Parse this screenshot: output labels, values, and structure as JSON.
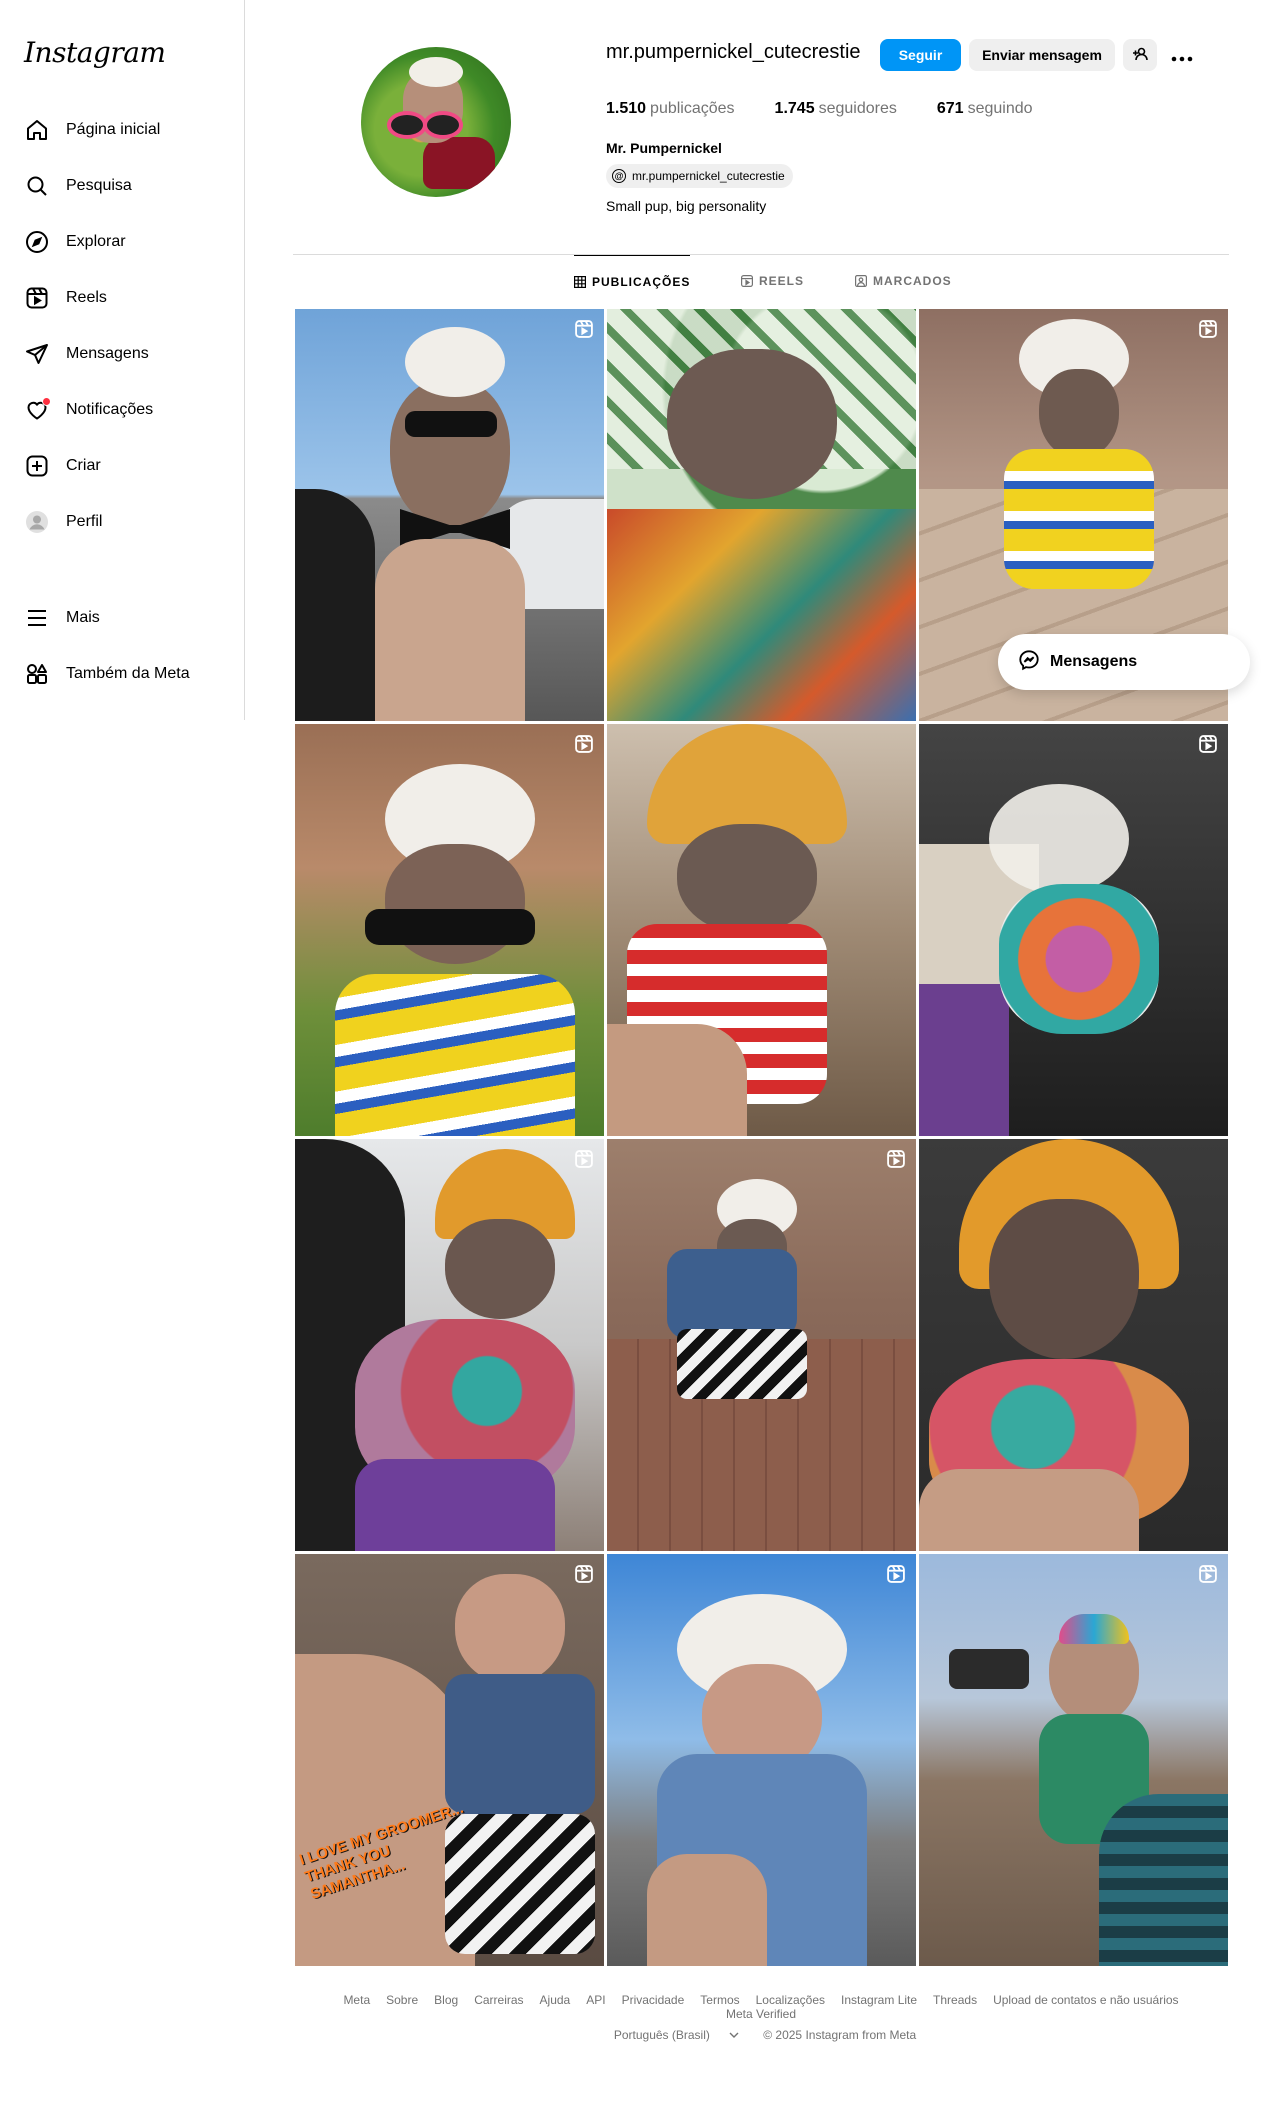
{
  "app": {
    "logo": "Instagram"
  },
  "sidebar": {
    "items": [
      {
        "label": "Página inicial",
        "icon": "home-icon"
      },
      {
        "label": "Pesquisa",
        "icon": "search-icon"
      },
      {
        "label": "Explorar",
        "icon": "compass-icon"
      },
      {
        "label": "Reels",
        "icon": "reels-icon"
      },
      {
        "label": "Mensagens",
        "icon": "send-icon"
      },
      {
        "label": "Notificações",
        "icon": "heart-icon"
      },
      {
        "label": "Criar",
        "icon": "plus-square-icon"
      },
      {
        "label": "Perfil",
        "icon": "avatar-icon"
      }
    ],
    "more": {
      "label": "Mais",
      "icon": "menu-icon"
    },
    "meta": {
      "label": "Também da Meta",
      "icon": "grid-shapes-icon"
    }
  },
  "profile": {
    "username": "mr.pumpernickel_cutecrestie",
    "follow_label": "Seguir",
    "message_label": "Enviar mensagem",
    "posts_count": "1.510",
    "posts_label": "publicações",
    "followers_count": "1.745",
    "followers_label": "seguidores",
    "following_count": "671",
    "following_label": "seguindo",
    "full_name": "Mr. Pumpernickel",
    "threads_handle": "mr.pumpernickel_cutecrestie",
    "bio": "Small pup, big personality"
  },
  "tabs": [
    {
      "label": "PUBLICAÇÕES",
      "active": true
    },
    {
      "label": "REELS",
      "active": false
    },
    {
      "label": "MARCADOS",
      "active": false
    }
  ],
  "posts": [
    {
      "reel": true,
      "overlay": ""
    },
    {
      "reel": false,
      "overlay": ""
    },
    {
      "reel": true,
      "overlay": ""
    },
    {
      "reel": true,
      "overlay": ""
    },
    {
      "reel": false,
      "overlay": ""
    },
    {
      "reel": true,
      "overlay": ""
    },
    {
      "reel": true,
      "overlay": ""
    },
    {
      "reel": true,
      "overlay": ""
    },
    {
      "reel": false,
      "overlay": ""
    },
    {
      "reel": true,
      "overlay": "I LOVE MY GROOMER... THANK YOU SAMANTHA..."
    },
    {
      "reel": true,
      "overlay": ""
    },
    {
      "reel": true,
      "overlay": ""
    }
  ],
  "floating": {
    "messages_label": "Mensagens"
  },
  "footer": {
    "links": [
      "Meta",
      "Sobre",
      "Blog",
      "Carreiras",
      "Ajuda",
      "API",
      "Privacidade",
      "Termos",
      "Localizações",
      "Instagram Lite",
      "Threads",
      "Upload de contatos e não usuários",
      "Meta Verified"
    ],
    "language": "Português (Brasil)",
    "copyright": "© 2025 Instagram from Meta"
  },
  "colors": {
    "accent": "#0095f6",
    "notification": "#ff3040",
    "muted": "#737373"
  }
}
